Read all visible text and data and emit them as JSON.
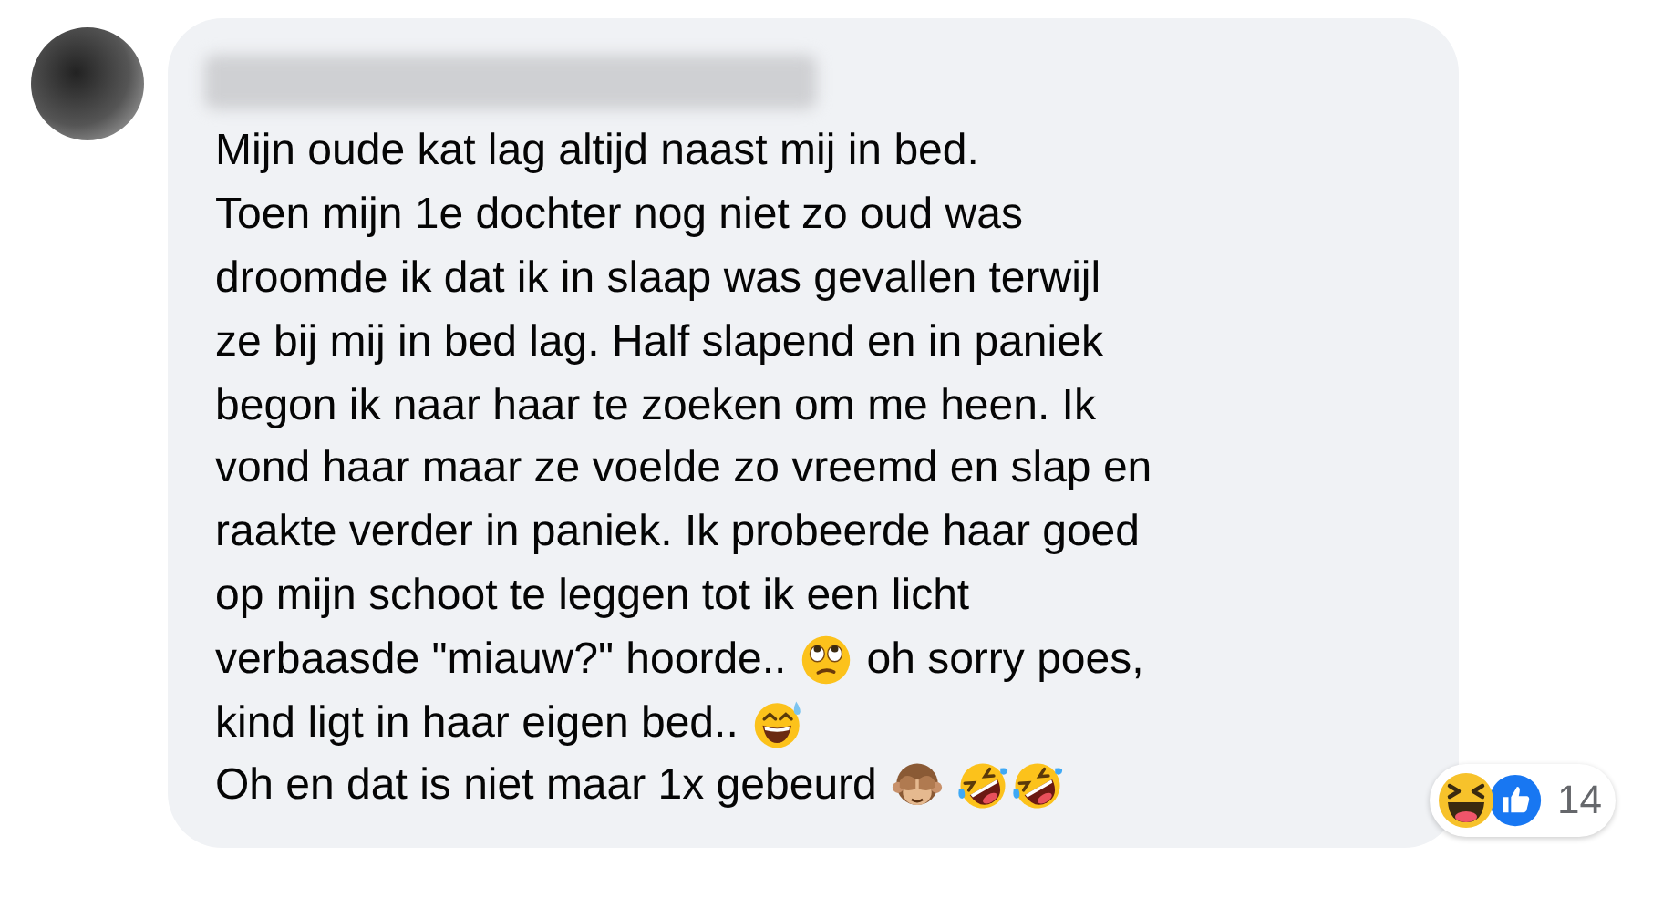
{
  "comment": {
    "lines": [
      [
        {
          "kind": "text",
          "text": "Mijn oude kat lag altijd naast mij in bed."
        }
      ],
      [
        {
          "kind": "text",
          "text": "Toen mijn 1e dochter nog niet zo oud was"
        }
      ],
      [
        {
          "kind": "text",
          "text": "droomde ik dat ik in slaap was gevallen terwijl"
        }
      ],
      [
        {
          "kind": "text",
          "text": "ze bij mij in bed lag. Half slapend en in paniek"
        }
      ],
      [
        {
          "kind": "text",
          "text": "begon ik naar haar te zoeken om me heen. Ik"
        }
      ],
      [
        {
          "kind": "text",
          "text": "vond haar maar ze voelde zo vreemd en slap en"
        }
      ],
      [
        {
          "kind": "text",
          "text": "raakte verder in paniek. Ik probeerde haar goed"
        }
      ],
      [
        {
          "kind": "text",
          "text": "op mijn schoot te leggen tot ik een licht"
        }
      ],
      [
        {
          "kind": "text",
          "text": "verbaasde \"miauw?\" hoorde.."
        },
        {
          "kind": "eyeroll"
        },
        {
          "kind": "text",
          "text": "oh sorry poes,"
        }
      ],
      [
        {
          "kind": "text",
          "text": "kind ligt in haar eigen bed.."
        },
        {
          "kind": "sweatsmile"
        }
      ],
      [
        {
          "kind": "text",
          "text": "Oh en dat is niet maar 1x gebeurd"
        },
        {
          "kind": "seenoevil"
        },
        {
          "kind": "rofl"
        },
        {
          "kind": "rofl"
        }
      ]
    ]
  },
  "reactions": {
    "icons": [
      {
        "kind": "haha"
      },
      {
        "kind": "like"
      }
    ],
    "count": "14"
  }
}
